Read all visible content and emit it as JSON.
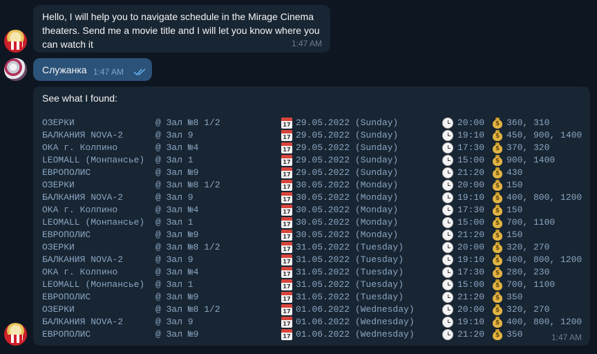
{
  "messages": {
    "bot_intro": {
      "text": "Hello, I will help you to navigate schedule in the Mirage Cinema\ntheaters. Send me a movie title and I will let you know where you\ncan watch it",
      "time": "1:47 AM"
    },
    "user_query": {
      "text": "Служанка",
      "time": "1:47 AM",
      "status": "read"
    },
    "bot_results": {
      "header": "See what I found:",
      "time": "1:47 AM",
      "rows": [
        {
          "theater": "ОЗЕРКИ",
          "hall": "@ Зал №8 1/2",
          "date": "29.05.2022 (Sunday)",
          "time": "20:00",
          "price": "360, 310"
        },
        {
          "theater": "БАЛКАНИЯ NOVA-2",
          "hall": "@ Зал 9",
          "date": "29.05.2022 (Sunday)",
          "time": "19:10",
          "price": "450, 900, 1400"
        },
        {
          "theater": "ОКА г. Колпино",
          "hall": "@ Зал №4",
          "date": "29.05.2022 (Sunday)",
          "time": "17:30",
          "price": "370, 320"
        },
        {
          "theater": "LEOMALL (Монпансье)",
          "hall": "@ Зал 1",
          "date": "29.05.2022 (Sunday)",
          "time": "15:00",
          "price": "900, 1400"
        },
        {
          "theater": "ЕВРОПОЛИС",
          "hall": "@ Зал №9",
          "date": "29.05.2022 (Sunday)",
          "time": "21:20",
          "price": "430"
        },
        {
          "theater": "ОЗЕРКИ",
          "hall": "@ Зал №8 1/2",
          "date": "30.05.2022 (Monday)",
          "time": "20:00",
          "price": "150"
        },
        {
          "theater": "БАЛКАНИЯ NOVA-2",
          "hall": "@ Зал 9",
          "date": "30.05.2022 (Monday)",
          "time": "19:10",
          "price": "400, 800, 1200"
        },
        {
          "theater": "ОКА г. Колпино",
          "hall": "@ Зал №4",
          "date": "30.05.2022 (Monday)",
          "time": "17:30",
          "price": "150"
        },
        {
          "theater": "LEOMALL (Монпансье)",
          "hall": "@ Зал 1",
          "date": "30.05.2022 (Monday)",
          "time": "15:00",
          "price": "700, 1100"
        },
        {
          "theater": "ЕВРОПОЛИС",
          "hall": "@ Зал №9",
          "date": "30.05.2022 (Monday)",
          "time": "21:20",
          "price": "150"
        },
        {
          "theater": "ОЗЕРКИ",
          "hall": "@ Зал №8 1/2",
          "date": "31.05.2022 (Tuesday)",
          "time": "20:00",
          "price": "320, 270"
        },
        {
          "theater": "БАЛКАНИЯ NOVA-2",
          "hall": "@ Зал 9",
          "date": "31.05.2022 (Tuesday)",
          "time": "19:10",
          "price": "400, 800, 1200"
        },
        {
          "theater": "ОКА г. Колпино",
          "hall": "@ Зал №4",
          "date": "31.05.2022 (Tuesday)",
          "time": "17:30",
          "price": "280, 230"
        },
        {
          "theater": "LEOMALL (Монпансье)",
          "hall": "@ Зал 1",
          "date": "31.05.2022 (Tuesday)",
          "time": "15:00",
          "price": "700, 1100"
        },
        {
          "theater": "ЕВРОПОЛИС",
          "hall": "@ Зал №9",
          "date": "31.05.2022 (Tuesday)",
          "time": "21:20",
          "price": "350"
        },
        {
          "theater": "ОЗЕРКИ",
          "hall": "@ Зал №8 1/2",
          "date": "01.06.2022 (Wednesday)",
          "time": "20:00",
          "price": "320, 270"
        },
        {
          "theater": "БАЛКАНИЯ NOVA-2",
          "hall": "@ Зал 9",
          "date": "01.06.2022 (Wednesday)",
          "time": "19:10",
          "price": "400, 800, 1200"
        },
        {
          "theater": "ЕВРОПОЛИС",
          "hall": "@ Зал №9",
          "date": "01.06.2022 (Wednesday)",
          "time": "21:20",
          "price": "350"
        }
      ]
    }
  },
  "icons": {
    "date": "calendar-icon",
    "time": "clock-icon",
    "price": "money-bag-icon",
    "read_status": "double-check-icon"
  },
  "colors": {
    "background": "#0e1621",
    "incoming_bubble": "#182533",
    "outgoing_bubble": "#2b5278",
    "monospace_text": "#8aa6c1",
    "read_ticks": "#6ab3f3"
  }
}
